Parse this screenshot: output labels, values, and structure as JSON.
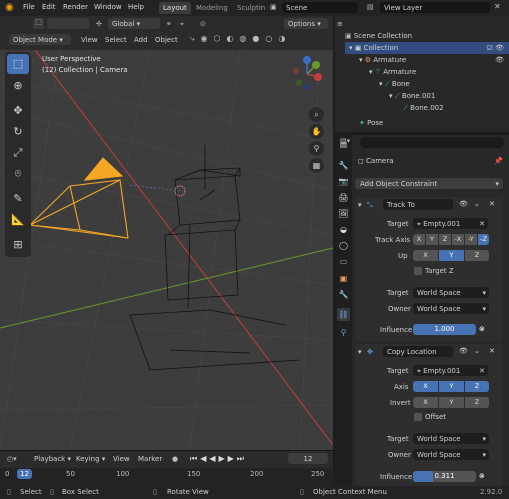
{
  "topbar": {
    "menus": [
      "File",
      "Edit",
      "Render",
      "Window",
      "Help"
    ],
    "workspaces": [
      "Layout",
      "Modeling",
      "Sculptin"
    ],
    "scene": "Scene",
    "view_layer": "View Layer"
  },
  "viewport_header": {
    "mode": "Object Mode",
    "menus": [
      "View",
      "Select",
      "Add",
      "Object"
    ],
    "orientation": "Global",
    "options": "Options"
  },
  "viewport": {
    "perspective": "User Perspective",
    "collection": "(12) Collection | Camera"
  },
  "outliner": {
    "items": [
      {
        "label": "Scene Collection"
      },
      {
        "label": "Collection"
      },
      {
        "label": "Armature"
      },
      {
        "label": "Armature"
      },
      {
        "label": "Bone"
      },
      {
        "label": "Bone.001"
      },
      {
        "label": "Bone.002"
      },
      {
        "label": "Pose"
      }
    ]
  },
  "properties": {
    "object_name": "Camera",
    "add_constraint": "Add Object Constraint",
    "track_to": {
      "name": "Track To",
      "target_label": "Target",
      "target_value": "Empty.001",
      "track_axis_label": "Track Axis",
      "track_axes": [
        "X",
        "Y",
        "Z",
        "-X",
        "-Y",
        "-Z"
      ],
      "up_label": "Up",
      "up_axes": [
        "X",
        "Y",
        "Z"
      ],
      "target_z": "Target Z",
      "space_target_label": "Target",
      "space_target_value": "World Space",
      "space_owner_label": "Owner",
      "space_owner_value": "World Space",
      "influence_label": "Influence",
      "influence_value": "1.000"
    },
    "copy_location": {
      "name": "Copy Location",
      "target_label": "Target",
      "target_value": "Empty.001",
      "axis_label": "Axis",
      "axes": [
        "X",
        "Y",
        "Z"
      ],
      "invert_label": "Invert",
      "invert_axes": [
        "X",
        "Y",
        "Z"
      ],
      "offset": "Offset",
      "space_target_label": "Target",
      "space_target_value": "World Space",
      "space_owner_label": "Owner",
      "space_owner_value": "World Space",
      "influence_label": "Influence",
      "influence_value": "0.311"
    }
  },
  "timeline": {
    "menus": [
      "Playback",
      "Keying",
      "View",
      "Marker"
    ],
    "current_frame": "12",
    "frame_field": "12",
    "ticks": [
      "0",
      "50",
      "100",
      "150",
      "200",
      "250"
    ]
  },
  "statusbar": {
    "select": "Select",
    "box_select": "Box Select",
    "rotate_view": "Rotate View",
    "context_menu": "Object Context Menu",
    "version": "2.92.0"
  },
  "colors": {
    "accent": "#4772b3",
    "camera": "#f5a623",
    "x_axis": "#c43c3c",
    "y_axis": "#6a9a2a"
  }
}
